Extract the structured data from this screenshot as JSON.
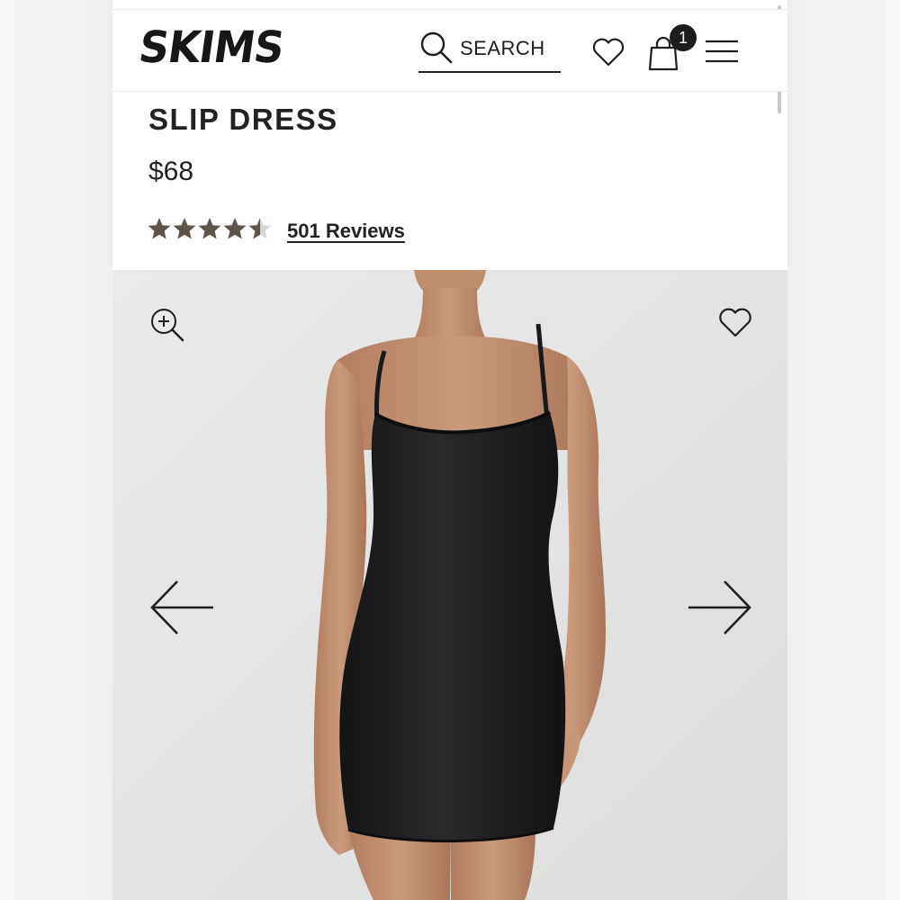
{
  "brand": {
    "logo_text": "SKIMS"
  },
  "header": {
    "search_label": "SEARCH",
    "cart_count": "1"
  },
  "product": {
    "title": "SLIP DRESS",
    "price": "$68",
    "rating": 4.5,
    "rating_max": 5,
    "reviews_label": "501 Reviews"
  },
  "icons": {
    "search": "search-icon",
    "wishlist": "heart-icon",
    "cart": "shopping-bag-icon",
    "menu": "hamburger-menu-icon",
    "zoom": "zoom-in-icon",
    "prev": "arrow-left-icon",
    "next": "arrow-right-icon"
  },
  "colors": {
    "star_filled": "#5e5448",
    "star_empty": "#d6d6d6",
    "hero_background": "#e6e7e6",
    "dress": "#1b1b1d",
    "skin": "#c49273"
  }
}
